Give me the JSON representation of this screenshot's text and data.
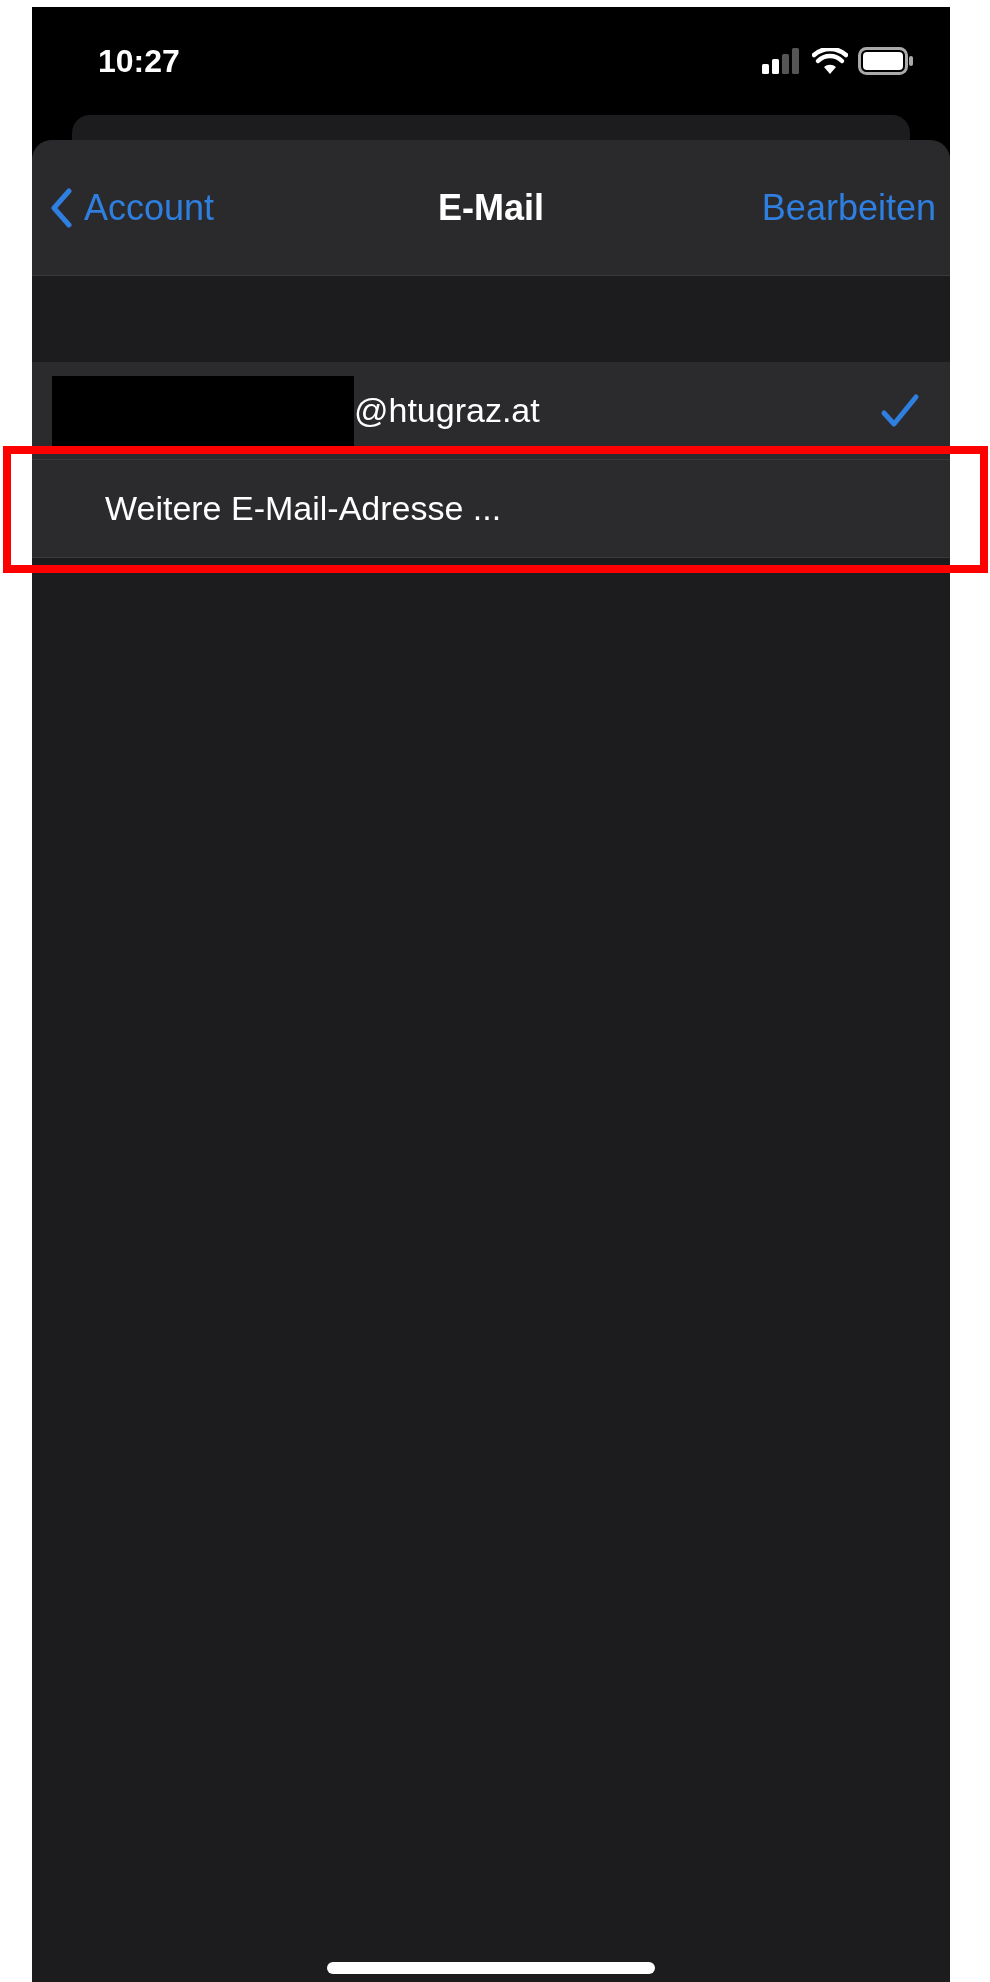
{
  "status_bar": {
    "time": "10:27"
  },
  "nav": {
    "back_label": "Account",
    "title": "E-Mail",
    "action": "Bearbeiten"
  },
  "rows": [
    {
      "kind": "address",
      "redacted": true,
      "label": "@htugraz.at",
      "selected": true,
      "highlighted": false
    },
    {
      "kind": "action",
      "label": "Weitere E-Mail-Adresse ...",
      "selected": false,
      "highlighted": true
    }
  ]
}
